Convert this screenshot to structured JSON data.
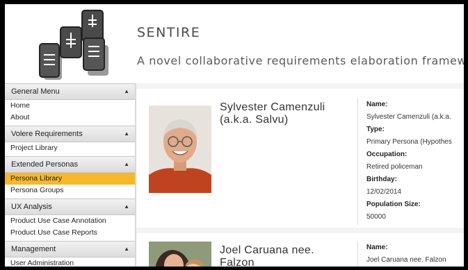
{
  "header": {
    "title": "SENTIRE",
    "tagline": "A novel collaborative requirements elaboration framework tha"
  },
  "sidebar": {
    "groups": [
      {
        "title": "General Menu",
        "items": [
          "Home",
          "About"
        ]
      },
      {
        "title": "Volere Requirements",
        "items": [
          "Project Library"
        ]
      },
      {
        "title": "Extended Personas",
        "items": [
          "Persona Library",
          "Persona Groups"
        ]
      },
      {
        "title": "UX Analysis",
        "items": [
          "Product Use Case Annotation",
          "Product Use Case Reports"
        ]
      },
      {
        "title": "Management",
        "items": [
          "User Administration"
        ]
      }
    ],
    "active_item": "Persona Library"
  },
  "personas": [
    {
      "name_line1": "Sylvester Camenzuli",
      "name_line2": "(a.k.a. Salvu)",
      "fields": {
        "name_label": "Name:",
        "name": "Sylvester Camenzuli (a.k.a.",
        "type_label": "Type:",
        "type": "Primary Persona (Hypothes",
        "occupation_label": "Occupation:",
        "occupation": "Retired policeman",
        "birthday_label": "Birthday:",
        "birthday": "12/02/2014",
        "population_label": "Population Size:",
        "population": "50000"
      }
    },
    {
      "name_line1": "Joel Caruana nee.",
      "name_line2": "Falzon",
      "fields": {
        "name_label": "Name:",
        "name": "Joel Caruana nee. Falzon"
      }
    }
  ],
  "colors": {
    "active_nav": "#f6b82a",
    "sidebar_header": "#e6e6e6",
    "main_bg": "#f3f3f3"
  }
}
